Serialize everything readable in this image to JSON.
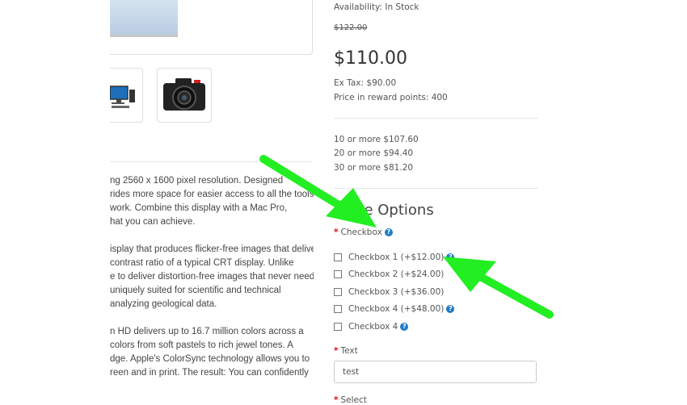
{
  "product": {
    "availability": "Availability: In Stock",
    "old_price": "$122.00",
    "price": "$110.00",
    "ex_tax": "Ex Tax: $90.00",
    "reward_points": "Price in reward points: 400",
    "discounts": [
      "10 or more $107.60",
      "20 or more $94.40",
      "30 or more $81.20"
    ]
  },
  "description": {
    "paragraphs": [
      [
        "ng 2560 x 1600 pixel resolution. Designed",
        "rides more space for easier access to all the tools",
        "work. Combine this display with a Mac Pro,",
        "hat you can achieve."
      ],
      [
        "isplay that produces flicker-free images that deliver",
        "contrast ratio of a typical CRT display. Unlike",
        "e to deliver distortion-free images that never need",
        "uniquely suited for scientific and technical",
        "analyzing geological data."
      ],
      [
        "n HD delivers up to 16.7 million colors across a",
        "colors from soft pastels to rich jewel tones. A",
        "dge. Apple's ColorSync technology allows you to",
        "reen and in print. The result: You can confidently"
      ]
    ]
  },
  "options": {
    "heading": "ilable Options",
    "checkbox_label": "Checkbox",
    "checkboxes": [
      {
        "label": "Checkbox 1 (+$12.00)",
        "help": true
      },
      {
        "label": "Checkbox 2 (+$24.00)",
        "help": false
      },
      {
        "label": "Checkbox 3 (+$36.00)",
        "help": false
      },
      {
        "label": "Checkbox 4 (+$48.00)",
        "help": true
      },
      {
        "label": "Checkbox 4",
        "help": true
      }
    ],
    "text_label": "Text",
    "text_value": "test",
    "select_label": "Select",
    "required_mark": "*",
    "help_glyph": "?"
  },
  "colors": {
    "arrow": "#22ee22",
    "help_icon": "#1e7bc6",
    "required": "#ee0000"
  }
}
